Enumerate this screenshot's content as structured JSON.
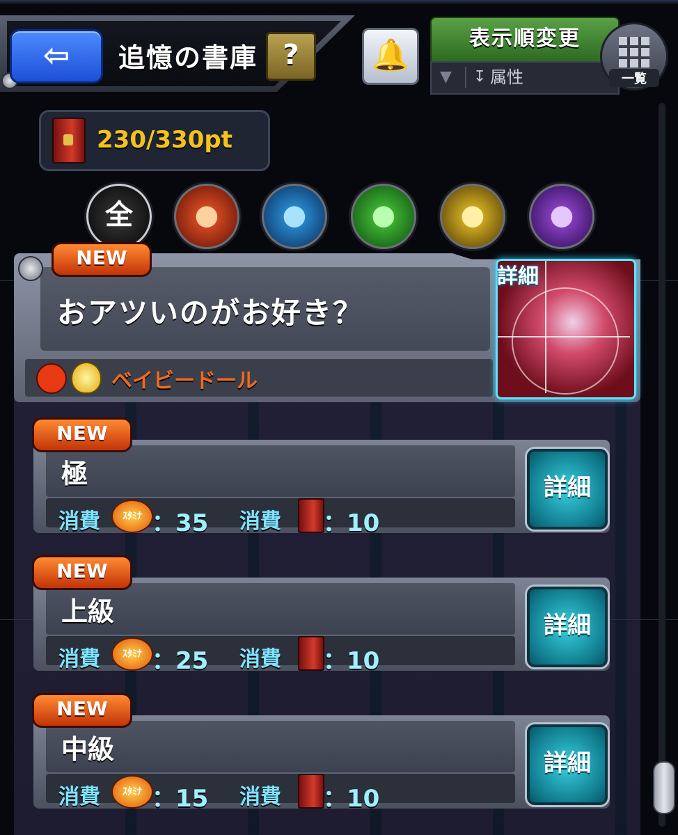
{
  "header": {
    "back_icon": "back-arrow-icon",
    "back_glyph": "⇦",
    "title": "追憶の書庫",
    "help_glyph": "?",
    "bell_icon": "bell-icon",
    "bell_glyph": "🔔",
    "sort_label": "表示順変更",
    "filter_icon": "funnel-icon",
    "filter_glyph": "▼",
    "sort_order_glyph": "↧",
    "filter_value": "属性",
    "list_label": "一覧"
  },
  "points": {
    "value": "230/330pt"
  },
  "element_filters": [
    {
      "label": "全",
      "icon": "all-element-icon"
    },
    {
      "label": "●",
      "icon": "fire-element-icon",
      "color": "#f15a2a"
    },
    {
      "label": "●",
      "icon": "water-element-icon",
      "color": "#2fa1e8"
    },
    {
      "label": "●",
      "icon": "wood-element-icon",
      "color": "#4ad03a"
    },
    {
      "label": "●",
      "icon": "light-element-icon",
      "color": "#f2cb2a"
    },
    {
      "label": "●",
      "icon": "dark-element-icon",
      "color": "#a04de0"
    }
  ],
  "quest": {
    "badge": "NEW",
    "title": "おアツいのがお好き？",
    "boss_name": "ベイビードール",
    "detail_label": "詳細"
  },
  "difficulties": [
    {
      "badge": "NEW",
      "name": "極",
      "cost_label": "消費",
      "stamina_label": "ｽﾀﾐﾅ",
      "stamina": "：35",
      "pt_cost": "：10",
      "detail_label": "詳細"
    },
    {
      "badge": "NEW",
      "name": "上級",
      "cost_label": "消費",
      "stamina_label": "ｽﾀﾐﾅ",
      "stamina": "：25",
      "pt_cost": "：10",
      "detail_label": "詳細"
    },
    {
      "badge": "NEW",
      "name": "中級",
      "cost_label": "消費",
      "stamina_label": "ｽﾀﾐﾅ",
      "stamina": "：15",
      "pt_cost": "：10",
      "detail_label": "詳細"
    }
  ],
  "colors": {
    "accent_orange": "#f26a1e",
    "cost_cyan": "#7fe2ff",
    "points_yellow": "#f4c21f",
    "sort_green": "#5aa046"
  }
}
